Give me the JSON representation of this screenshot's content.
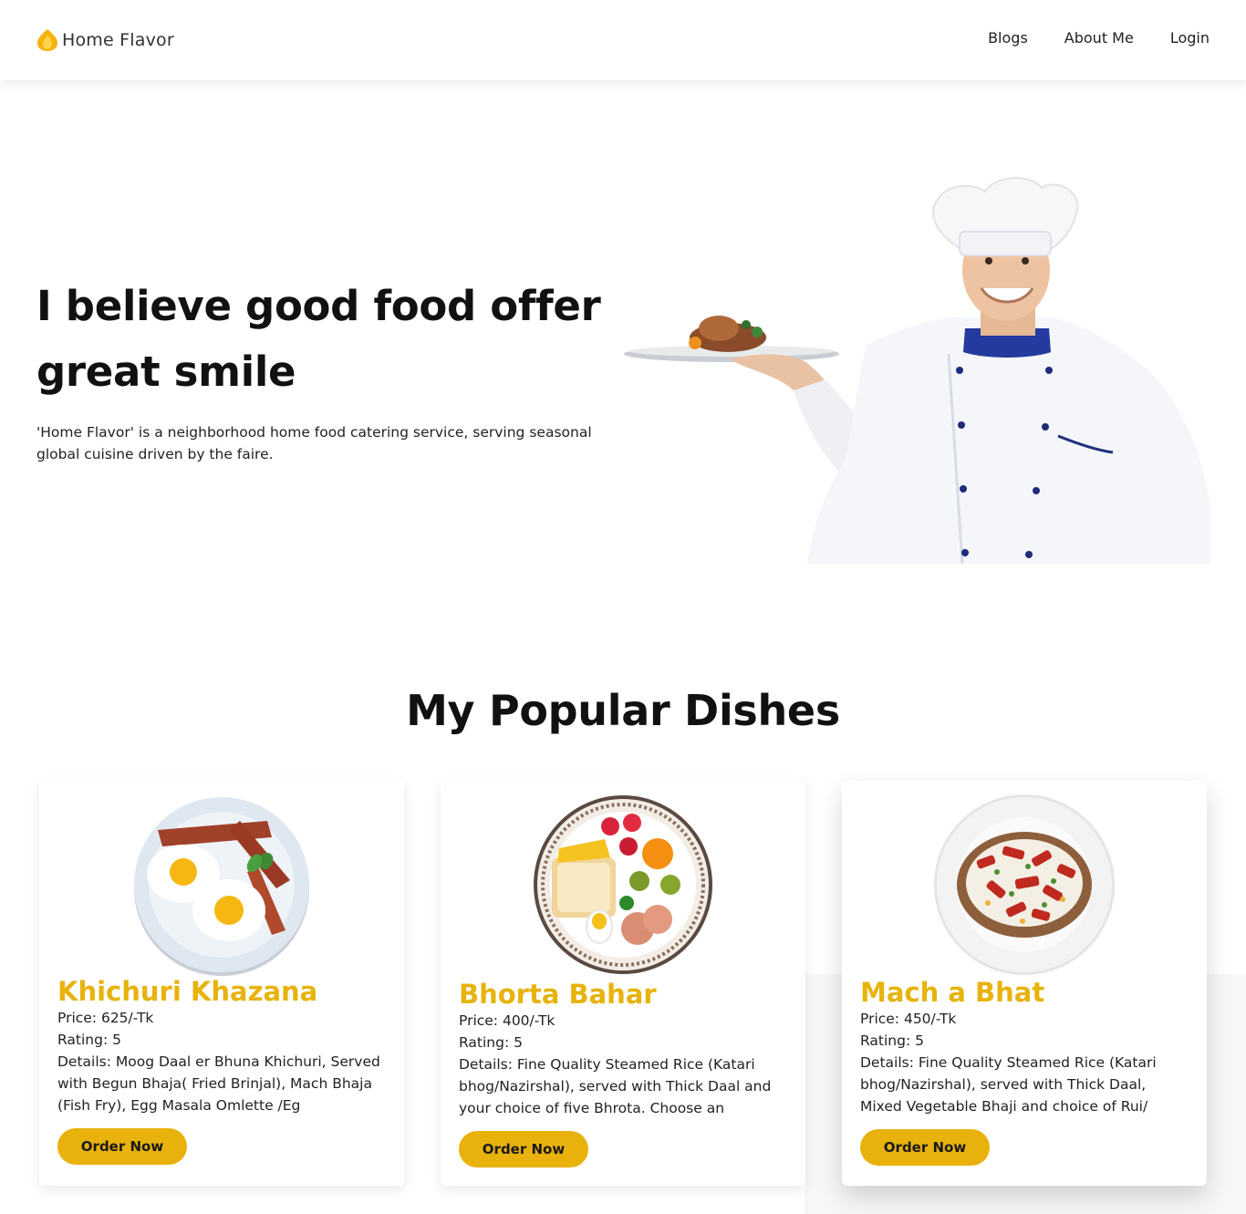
{
  "header": {
    "brand_name": "Home Flavor",
    "brand_icon": "flame-icon",
    "nav": [
      {
        "label": "Blogs"
      },
      {
        "label": "About Me"
      },
      {
        "label": "Login"
      }
    ]
  },
  "hero": {
    "title_line1": "I believe good food offer",
    "title_line2": "great smile",
    "description": "'Home Flavor' is a neighborhood home food catering service, serving seasonal global cuisine driven by the faire.",
    "image": "chef-holding-plate"
  },
  "dishes_section": {
    "title": "My Popular Dishes",
    "dishes": [
      {
        "name": "Khichuri Khazana",
        "price": "Price: 625/-Tk",
        "rating": "Rating: 5",
        "details": "Details: Moog Daal er Bhuna Khichuri, Served with Begun Bhaja( Fried Brinjal), Mach Bhaja (Fish Fry), Egg Masala Omlette /Eg",
        "button": "Order Now",
        "image": "eggs-and-bacon-plate"
      },
      {
        "name": "Bhorta Bahar",
        "price": "Price: 400/-Tk",
        "rating": "Rating: 5",
        "details": "Details: Fine Quality Steamed Rice (Katari bhog/Nazirshal), served with Thick Daal and your choice of five Bhrota. Choose an",
        "button": "Order Now",
        "image": "breakfast-fruit-plate"
      },
      {
        "name": "Mach a Bhat",
        "price": "Price: 450/-Tk",
        "rating": "Rating: 5",
        "details": "Details: Fine Quality Steamed Rice (Katari bhog/Nazirshal), served with Thick Daal, Mixed Vegetable Bhaji and choice of Rui/",
        "button": "Order Now",
        "image": "loaded-potato-plate"
      }
    ]
  },
  "colors": {
    "accent": "#e8b10b",
    "dish_title": "#e7b30c",
    "text": "#111111"
  }
}
